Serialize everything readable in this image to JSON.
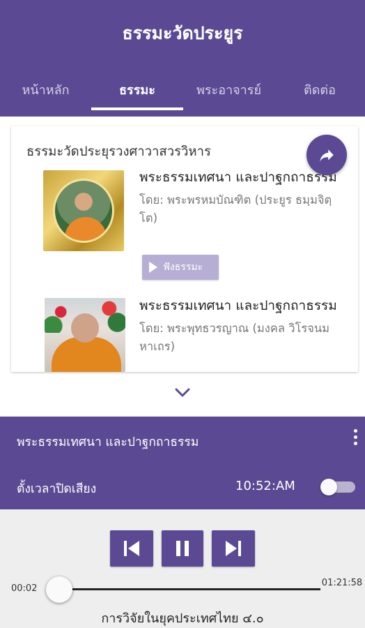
{
  "app": {
    "title": "ธรรมะวัดประยูร"
  },
  "tabs": [
    {
      "label": "หน้าหลัก",
      "active": false
    },
    {
      "label": "ธรรมะ",
      "active": true
    },
    {
      "label": "พระอาจารย์",
      "active": false
    },
    {
      "label": "ติดต่อ",
      "active": false
    }
  ],
  "card": {
    "title": "ธรรมะวัดประยุรวงศาวาสวรวิหาร",
    "items": [
      {
        "title": "พระธรรมเทศนา และปาฐกถาธรรม",
        "by": "โดย: พระพรหมบัณฑิต (ประยูร ธมฺมจิตฺโต)",
        "button_label": "ฟังธรรมะ",
        "image": "monk-portrait-gold-frame"
      },
      {
        "title": "พระธรรมเทศนา และปาฐกถาธรรม",
        "by": "โดย: พระพุทธวรญาณ (มงคล วิโรจนมหาเถร)",
        "image": "elder-monk-photo"
      }
    ]
  },
  "player": {
    "now_playing": "พระธรรมเทศนา และปาฐกถาธรรม",
    "timer_label": "ตั้งเวลาปิดเสียง",
    "timer_time": "10:52:AM",
    "timer_enabled": false,
    "elapsed": "00:02",
    "total": "01:21:58",
    "progress": 0.0004,
    "track_title": "การวิจัยในยุคประเทศไทย ๔.๐"
  },
  "colors": {
    "primary": "#5b4a93",
    "button_disabled": "#b7aed6",
    "controls_bg": "#eeeeee"
  },
  "icons": [
    "share-icon",
    "chevron-down-icon",
    "more-vert-icon",
    "skip-previous-icon",
    "pause-icon",
    "skip-next-icon",
    "play-icon"
  ]
}
